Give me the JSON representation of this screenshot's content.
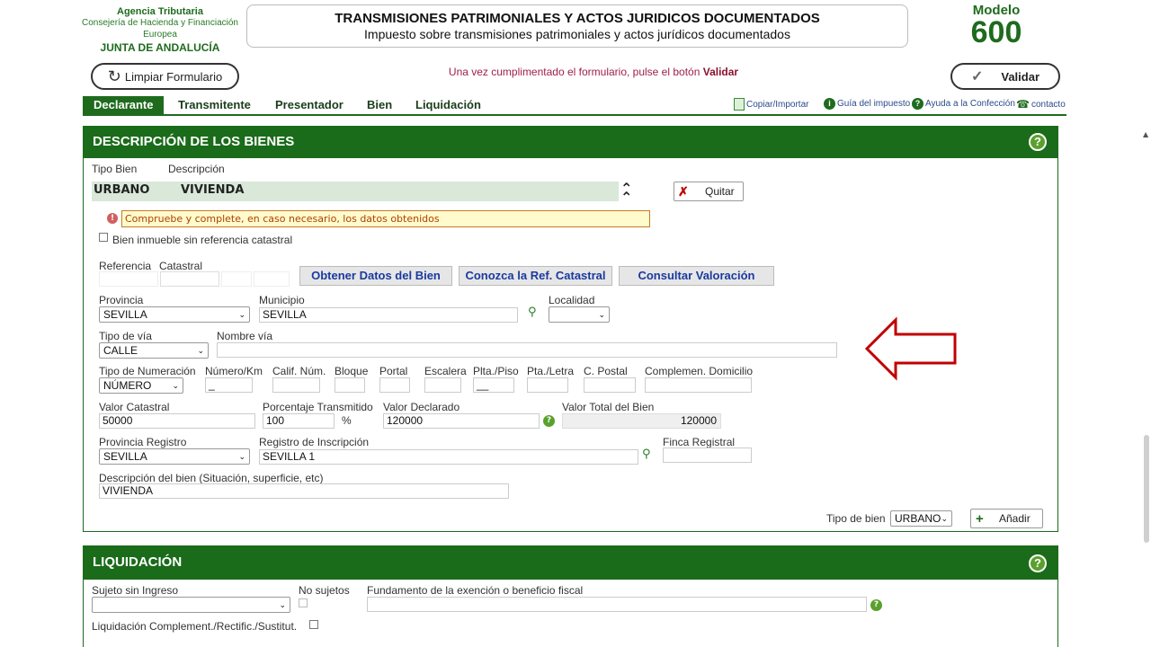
{
  "header": {
    "agency": "Agencia Tributaria",
    "consejeria_1": "Consejería de Hacienda y Financiación",
    "consejeria_2": "Europea",
    "junta": "JUNTA DE ANDALUCÍA",
    "title": "TRANSMISIONES PATRIMONIALES Y ACTOS JURIDICOS DOCUMENTADOS",
    "subtitle": "Impuesto sobre transmisiones patrimoniales y actos jurídicos documentados",
    "modelo_label": "Modelo",
    "modelo_number": "600"
  },
  "actions": {
    "clear_label": "Limpiar Formulario",
    "notice_prefix": "Una vez cumplimentado el formulario, pulse el botón",
    "notice_strong": "Validar",
    "validate_label": "Validar"
  },
  "nav": {
    "tabs": [
      "Declarante",
      "Transmitente",
      "Presentador",
      "Bien",
      "Liquidación"
    ],
    "utils": [
      "Copiar/Importar",
      "Guía del impuesto",
      "Ayuda a la Confección",
      "contacto"
    ]
  },
  "bienes": {
    "title": "DESCRIPCIÓN DE LOS BIENES",
    "col_tipo": "Tipo Bien",
    "col_desc": "Descripción",
    "row_tipo": "URBANO",
    "row_desc": "VIVIENDA",
    "quitar_label": "Quitar",
    "warning": "Compruebe y complete, en caso necesario, los datos obtenidos",
    "sin_ref_label": "Bien inmueble sin referencia catastral",
    "ref_label_1": "Referencia",
    "ref_label_2": "Catastral",
    "btn_obtener": "Obtener Datos del Bien",
    "btn_conozca": "Conozca la Ref. Catastral",
    "btn_consultar": "Consultar Valoración",
    "provincia_label": "Provincia",
    "provincia_value": "SEVILLA",
    "municipio_label": "Municipio",
    "municipio_value": "SEVILLA",
    "localidad_label": "Localidad",
    "localidad_value": "",
    "tipo_via_label": "Tipo de vía",
    "tipo_via_value": "CALLE",
    "nombre_via_label": "Nombre vía",
    "nombre_via_value": "",
    "tipo_num_label": "Tipo de Numeración",
    "tipo_num_value": "NÚMERO",
    "numero_label": "Número/Km",
    "numero_value": "_",
    "calif_label": "Calif. Núm.",
    "bloque_label": "Bloque",
    "portal_label": "Portal",
    "escalera_label": "Escalera",
    "planta_label": "Plta./Piso",
    "planta_value": "__",
    "puerta_label": "Pta./Letra",
    "cp_label": "C. Postal",
    "complemen_label": "Complemen. Domicilio",
    "valor_catastral_label": "Valor Catastral",
    "valor_catastral_value": "50000",
    "porcentaje_label": "Porcentaje Transmitido",
    "porcentaje_value": "100",
    "percent_sign": "%",
    "valor_declarado_label": "Valor Declarado",
    "valor_declarado_value": "120000",
    "valor_total_label": "Valor Total del Bien",
    "valor_total_value": "120000",
    "prov_registro_label": "Provincia Registro",
    "prov_registro_value": "SEVILLA",
    "registro_label": "Registro de Inscripción",
    "registro_value": "SEVILLA 1",
    "finca_label": "Finca Registral",
    "finca_value": "",
    "desc_bien_label": "Descripción del bien (Situación, superficie, etc)",
    "desc_bien_value": "VIVIENDA",
    "tipo_bien_label": "Tipo de bien",
    "tipo_bien_value": "URBANO",
    "anadir_label": "Añadir"
  },
  "liquidacion": {
    "title": "LIQUIDACIÓN",
    "sujeto_label": "Sujeto sin Ingreso",
    "no_sujetos_label": "No sujetos",
    "fundamento_label": "Fundamento de la exención o beneficio fiscal",
    "complement_label": "Liquidación Complement./Rectific./Sustitut."
  },
  "colors": {
    "green": "#1a6b1a",
    "accent_red": "#c00000",
    "notice_text": "#a0204a"
  }
}
